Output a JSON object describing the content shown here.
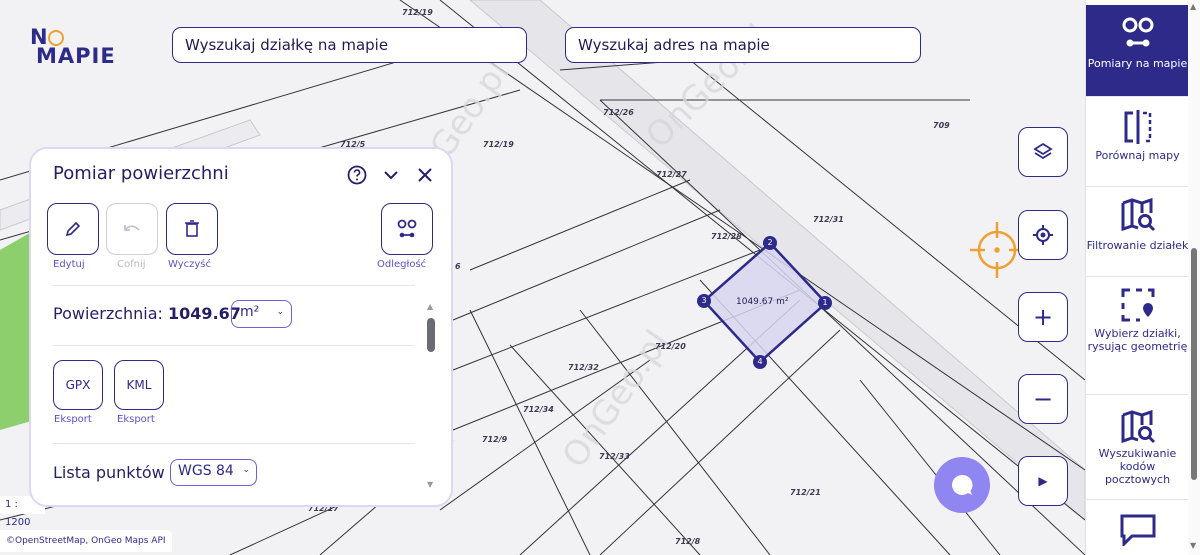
{
  "logo": {
    "line1a": "N",
    "line1b": "",
    "line2": "MAPIE"
  },
  "search": {
    "parcel_placeholder": "Wyszukaj działkę na mapie",
    "address_placeholder": "Wyszukaj adres na mapie"
  },
  "map": {
    "parcels": [
      "712/19",
      "712/26",
      "712/19",
      "712/5",
      "709",
      "712/27",
      "712/31",
      "712/28",
      "6",
      "712/20",
      "712/32",
      "712/34",
      "712/9",
      "712/33",
      "712/21",
      "712/17",
      "712/8"
    ],
    "polygon_area_label": "1049.67 m²",
    "vertices": [
      "1",
      "2",
      "3",
      "4"
    ],
    "watermark": "OnGeo.pl",
    "scale": "1 : 1200",
    "attribution": "©OpenStreetMap, OnGeo Maps API"
  },
  "panel": {
    "title": "Pomiar powierzchni",
    "tools": {
      "edit": "Edytuj",
      "undo": "Cofnij",
      "clear": "Wyczyść",
      "distance": "Odległość"
    },
    "area_label": "Powierzchnia:",
    "area_value": "1049.67",
    "unit_selected": "m²",
    "export": {
      "gpx": "GPX",
      "kml": "KML",
      "gpx_sub": "Eksport",
      "kml_sub": "Eksport"
    },
    "points_label": "Lista punktów",
    "crs_selected": "WGS 84"
  },
  "sidebar": {
    "items": [
      {
        "label": "Pomiary na mapie"
      },
      {
        "label": "Porównaj mapy"
      },
      {
        "label": "Filtrowanie działek"
      },
      {
        "label": "Wybierz działki, rysując geometrię"
      },
      {
        "label": "Wyszukiwanie kodów pocztowych"
      }
    ]
  },
  "colors": {
    "brand": "#2d2a8a",
    "accent": "#f0a033",
    "chat": "#8f86f2",
    "polygon_fill": "#d8d6f0"
  }
}
